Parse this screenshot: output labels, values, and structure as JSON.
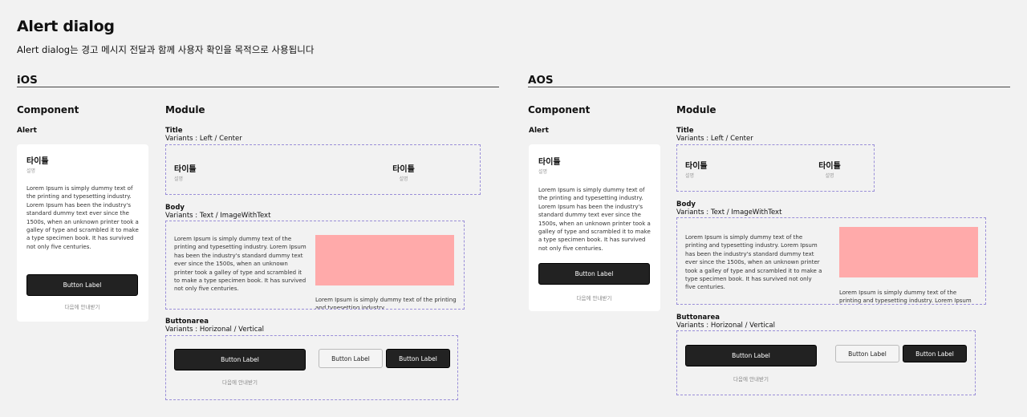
{
  "page": {
    "title": "Alert dialog",
    "description": "Alert dialog는 경고 메시지 전달과 함께 사용자 확인을 목적으로 사용됩니다"
  },
  "ios": {
    "platform": "iOS",
    "component_heading": "Component",
    "module_heading": "Module",
    "alert_label": "Alert",
    "alert": {
      "title": "타이틀",
      "subtitle": "설명",
      "body": "Lorem Ipsum is simply dummy text of the printing and typesetting industry. Lorem Ipsum has been the industry's standard dummy text ever since the 1500s, when an unknown printer took a galley of type and scrambled it to make a type specimen book. It has survived not only five centuries.",
      "button": "Button Label",
      "later": "다음에 안내받기"
    },
    "title_module": {
      "label": "Title",
      "variants": "Variants : Left / Center",
      "left_title": "타이틀",
      "left_sub": "설명",
      "center_title": "타이틀",
      "center_sub": "설명"
    },
    "body_module": {
      "label": "Body",
      "variants": "Variants : Text / ImageWithText",
      "text": "Lorem Ipsum is simply dummy text of the printing and typesetting industry. Lorem Ipsum has been the industry's standard dummy text ever since the 1500s, when an unknown printer took a galley of type and scrambled it to make a type specimen book. It has survived not only five centuries.",
      "image_text": "Lorem Ipsum is simply dummy text of the printing and typesetting industry."
    },
    "button_module": {
      "label": "Buttonarea",
      "variants": "Variants : Horizonal / Vertical",
      "primary": "Button Label",
      "later": "다음에 안내받기",
      "secondary": "Button Label",
      "tertiary": "Button Label"
    }
  },
  "aos": {
    "platform": "AOS",
    "component_heading": "Component",
    "module_heading": "Module",
    "alert_label": "Alert",
    "alert": {
      "title": "타이틀",
      "subtitle": "설명",
      "body": "Lorem Ipsum is simply dummy text of the printing and typesetting industry. Lorem Ipsum has been the industry's standard dummy text ever since the 1500s, when an unknown printer took a galley of type and scrambled it to make a type specimen book. It has survived not only five centuries.",
      "button": "Button Label",
      "later": "다음에 안내받기"
    },
    "title_module": {
      "label": "Title",
      "variants": "Variants : Left / Center",
      "left_title": "타이틀",
      "left_sub": "설명",
      "center_title": "타이틀",
      "center_sub": "설명"
    },
    "body_module": {
      "label": "Body",
      "variants": "Variants : Text / ImageWithText",
      "text": "Lorem Ipsum is simply dummy text of the printing and typesetting industry. Lorem Ipsum has been the industry's standard dummy text ever since the 1500s, when an unknown printer took a galley of type and scrambled it to make a type specimen book. It has survived not only five centuries.",
      "image_text": "Lorem Ipsum is simply dummy text of the printing and typesetting industry. Lorem Ipsum"
    },
    "button_module": {
      "label": "Buttonarea",
      "variants": "Variants : Horizonal / Vertical",
      "primary": "Button Label",
      "later": "다음에 안내받기",
      "secondary": "Button Label",
      "tertiary": "Button Label"
    }
  },
  "colors": {
    "background": "#f2f2f2",
    "dark_button": "#222222",
    "dashed_border": "#9a8fd8",
    "image_placeholder": "#ffaaaa"
  }
}
